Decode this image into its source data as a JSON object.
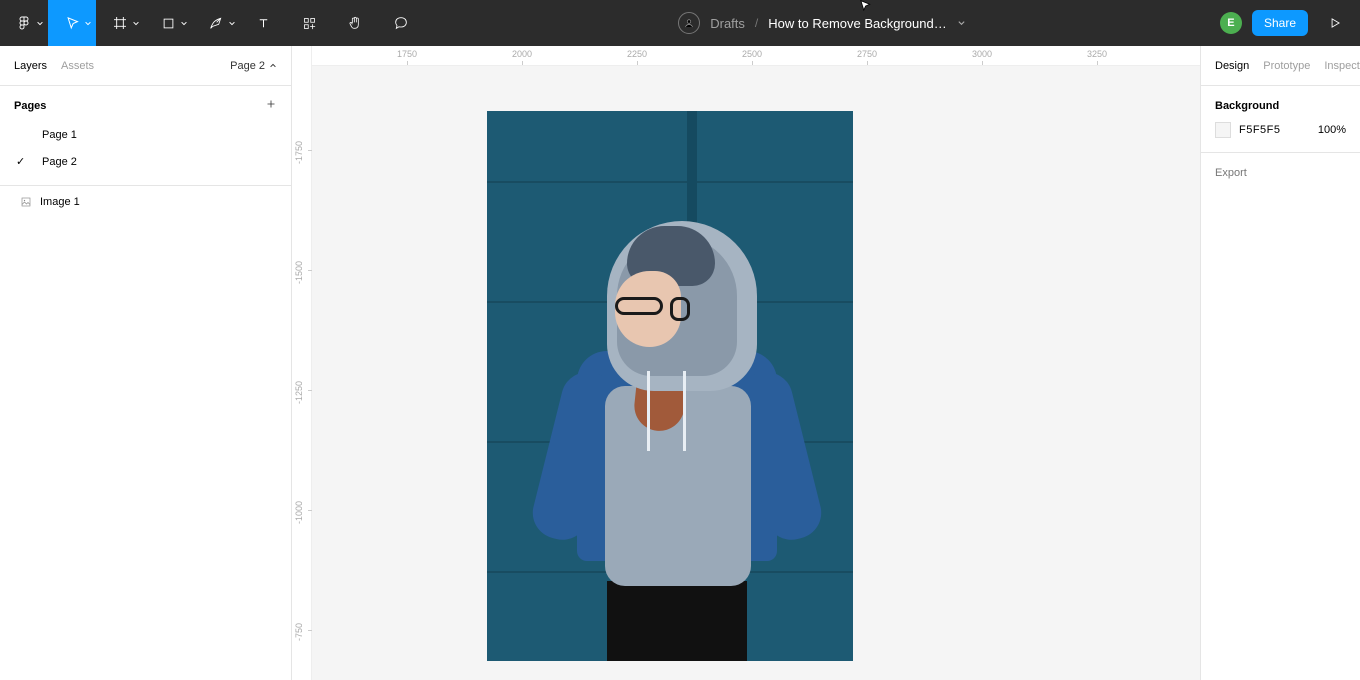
{
  "toolbar": {
    "tools": [
      "menu",
      "move",
      "frame",
      "shape",
      "pen",
      "text",
      "resources",
      "hand",
      "comment"
    ]
  },
  "breadcrumb": {
    "project": "Drafts",
    "file": "How to Remove Background…"
  },
  "topright": {
    "user_initial": "E",
    "share_label": "Share"
  },
  "left_tabs": {
    "layers": "Layers",
    "assets": "Assets",
    "page_selector": "Page 2"
  },
  "pages": {
    "header": "Pages",
    "items": [
      {
        "name": "Page 1",
        "active": false
      },
      {
        "name": "Page 2",
        "active": true
      }
    ]
  },
  "layers": {
    "items": [
      {
        "name": "Image 1",
        "type": "image"
      }
    ]
  },
  "ruler": {
    "h": [
      "1750",
      "2000",
      "2250",
      "2500",
      "2750",
      "3000",
      "3250"
    ],
    "v": [
      "-1750",
      "-1500",
      "-1250",
      "-1000",
      "-750"
    ]
  },
  "right_tabs": {
    "design": "Design",
    "prototype": "Prototype",
    "inspect": "Inspect"
  },
  "background": {
    "title": "Background",
    "hex": "F5F5F5",
    "opacity": "100%"
  },
  "export": {
    "label": "Export"
  }
}
